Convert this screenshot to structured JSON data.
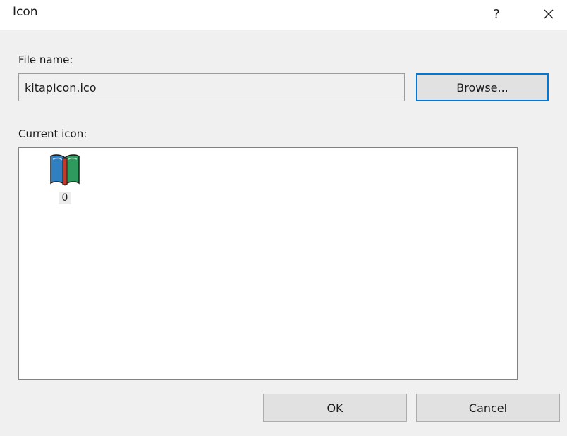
{
  "window": {
    "title": "Icon",
    "help_label": "?",
    "close_icon": "close-icon"
  },
  "file_name": {
    "label": "File name:",
    "value": "kitapIcon.ico",
    "browse_label": "Browse..."
  },
  "current_icon": {
    "label": "Current icon:",
    "items": [
      {
        "index": "0",
        "icon": "book-icon"
      }
    ]
  },
  "buttons": {
    "ok_label": "OK",
    "cancel_label": "Cancel"
  },
  "colors": {
    "accent": "#0078d7",
    "dialog_bg": "#f0f0f0",
    "book_blue": "#2f7fc1",
    "book_green": "#2e9a5e",
    "book_spine": "#c0392b"
  }
}
